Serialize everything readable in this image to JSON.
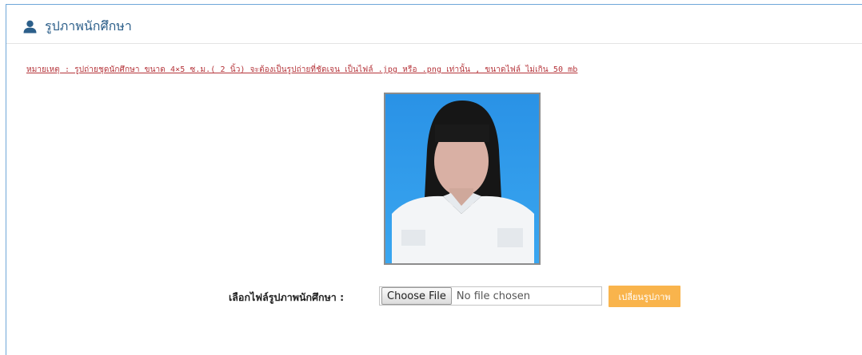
{
  "panel": {
    "title": "รูปภาพนักศึกษา",
    "note": "หมายเหตุ : รูปถ่ายชุดนักศึกษา ขนาด 4×5 ซ.ม.( 2 นิ้ว) จะต้องเป็นรูปถ่ายที่ชัดเจน เป็นไฟล์ .jpg หรือ .png เท่านั้น , ขนาดไฟล์ ไม่เกิน 50 mb"
  },
  "upload": {
    "label": "เลือกไฟล์รูปภาพนักศึกษา :",
    "choose_button": "Choose File",
    "status": "No file chosen",
    "submit_button": "เปลี่ยนรูปภาพ"
  },
  "icons": {
    "header": "user-icon"
  },
  "colors": {
    "accent": "#2c5f8a",
    "panel_border": "#6ea6d8",
    "note": "#b5343a",
    "submit_button": "#f9b44c",
    "photo_background": "#2c97e8"
  }
}
